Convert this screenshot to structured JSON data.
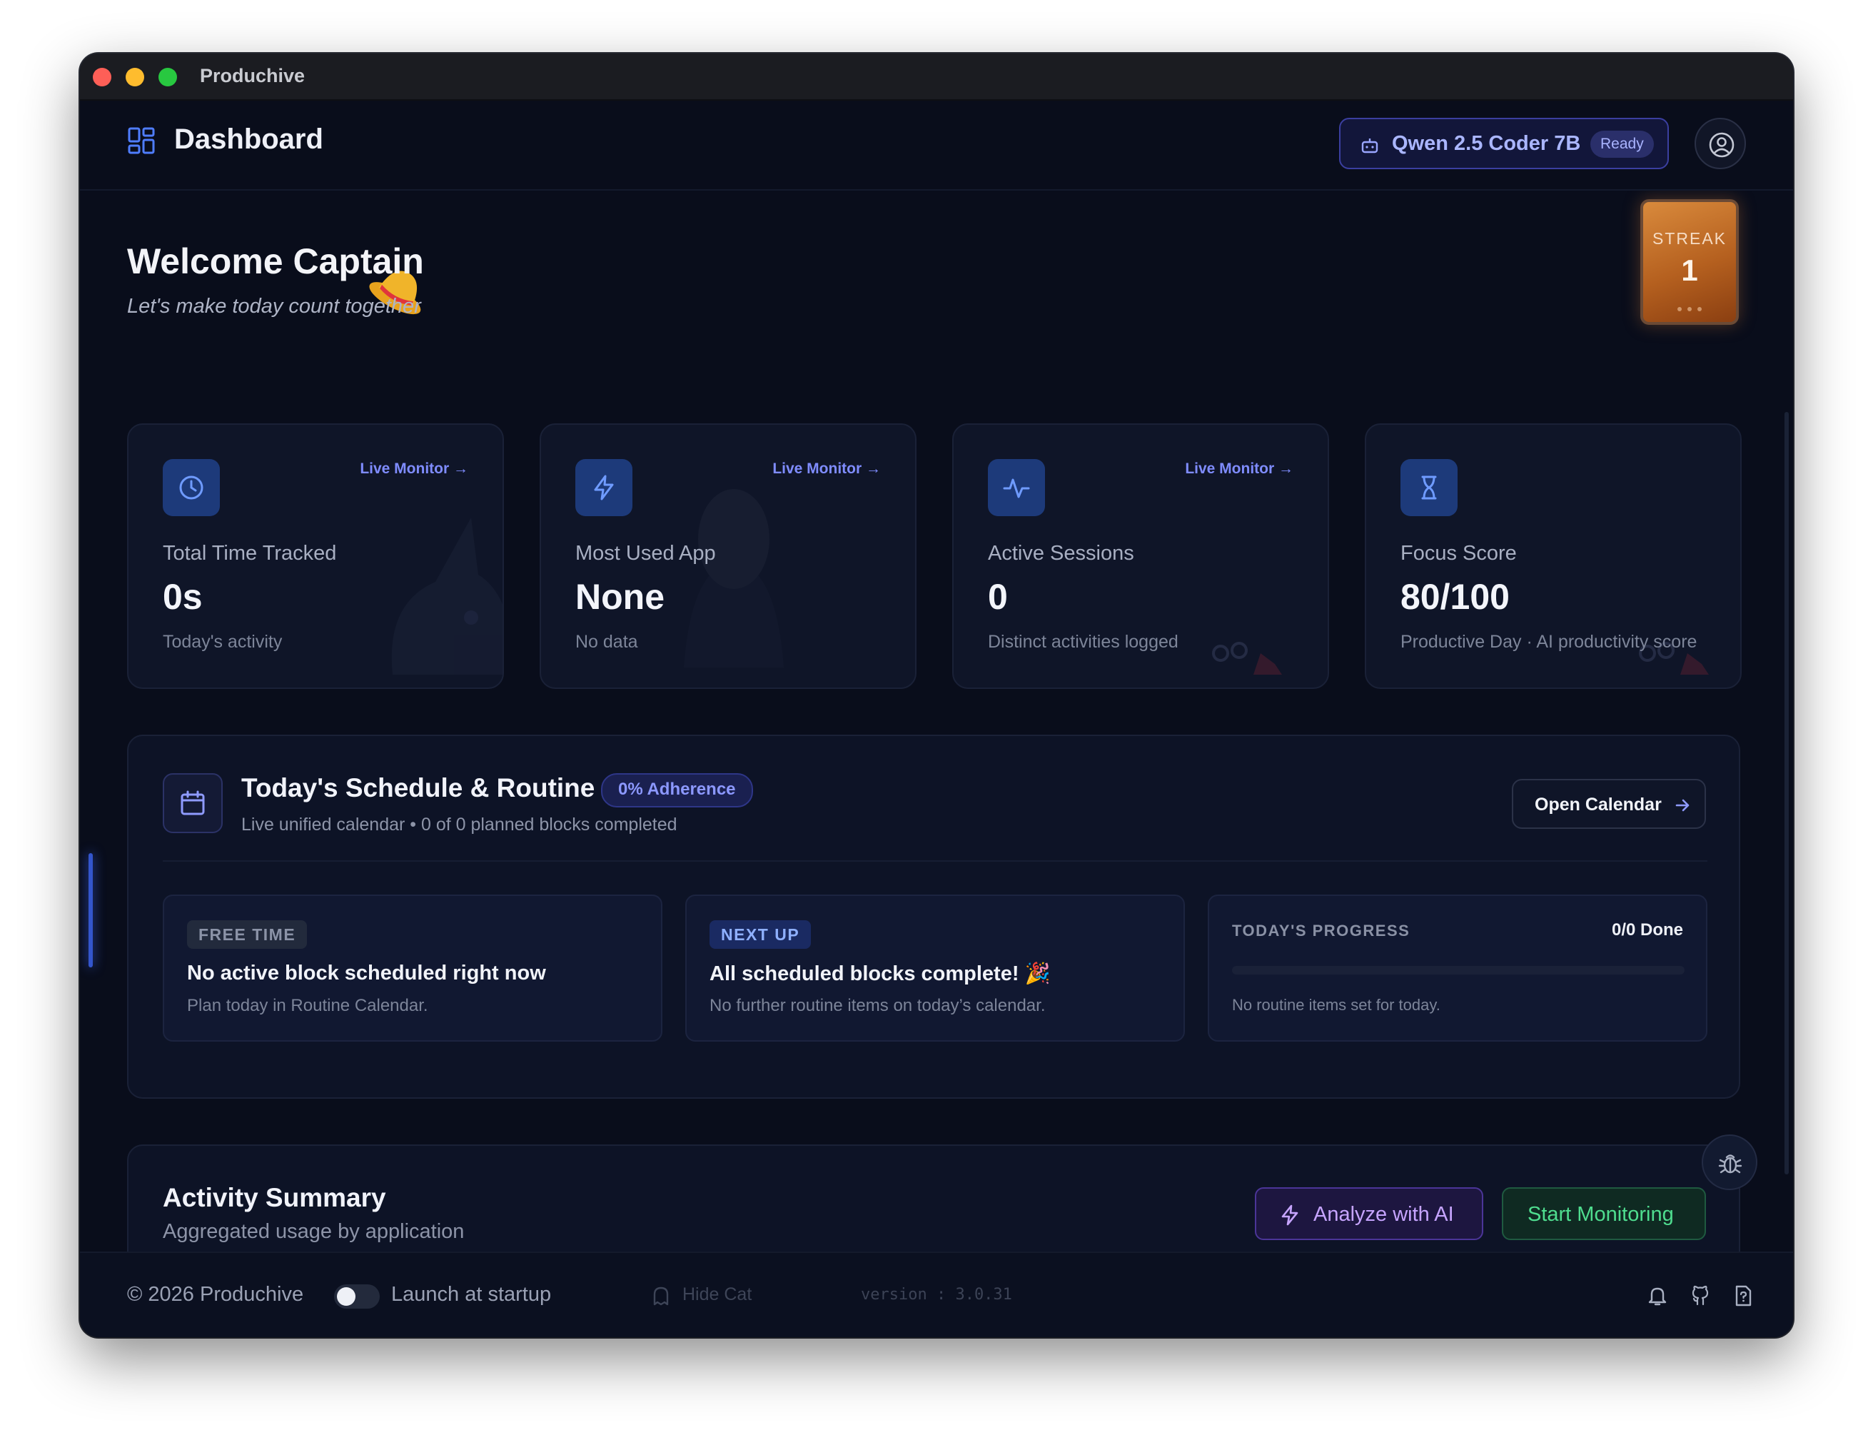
{
  "window": {
    "title": "Produchive"
  },
  "header": {
    "title": "Dashboard",
    "model": {
      "name": "Qwen 2.5 Coder 7B",
      "status": "Ready"
    }
  },
  "welcome": {
    "title": "Welcome Captain",
    "subtitle": "Let's make today count together"
  },
  "streak": {
    "label": "STREAK",
    "value": "1"
  },
  "stats": [
    {
      "icon": "clock-icon",
      "link": "Live Monitor",
      "label": "Total Time Tracked",
      "value": "0s",
      "sub": "Today's activity"
    },
    {
      "icon": "lightning-icon",
      "link": "Live Monitor",
      "label": "Most Used App",
      "value": "None",
      "sub": "No data"
    },
    {
      "icon": "activity-pulse-icon",
      "link": "Live Monitor",
      "label": "Active Sessions",
      "value": "0",
      "sub": "Distinct activities logged"
    },
    {
      "icon": "hourglass-icon",
      "link": "",
      "label": "Focus Score",
      "value": "80/100",
      "sub": "Productive Day · AI productivity score"
    }
  ],
  "schedule": {
    "title": "Today's Schedule & Routine",
    "adherence": "0% Adherence",
    "subtitle": "Live unified calendar • 0 of 0 planned blocks completed",
    "open_calendar": "Open Calendar",
    "free": {
      "tag": "FREE TIME",
      "title": "No active block scheduled right now",
      "sub": "Plan today in Routine Calendar."
    },
    "next": {
      "tag": "NEXT UP",
      "title": "All scheduled blocks complete! 🎉",
      "sub": "No further routine items on today’s calendar."
    },
    "progress": {
      "label": "TODAY'S PROGRESS",
      "done": "0/0 Done",
      "fraction": 0,
      "sub": "No routine items set for today."
    }
  },
  "activity": {
    "title": "Activity Summary",
    "subtitle": "Aggregated usage by application",
    "analyze": "Analyze with AI",
    "monitor": "Start Monitoring"
  },
  "footer": {
    "copyright": "© 2026 Produchive",
    "launch": "Launch at startup",
    "launch_enabled": false,
    "hide_cat": "Hide Cat",
    "version": "version : 3.0.31"
  },
  "colors": {
    "background": "#090d1b",
    "card": "#0f1528",
    "accent": "#7f8cff",
    "icon_tile": "#1d3a7a",
    "monitor_green": "#4fdd8f",
    "analyze_purple": "#c6a4ff"
  }
}
